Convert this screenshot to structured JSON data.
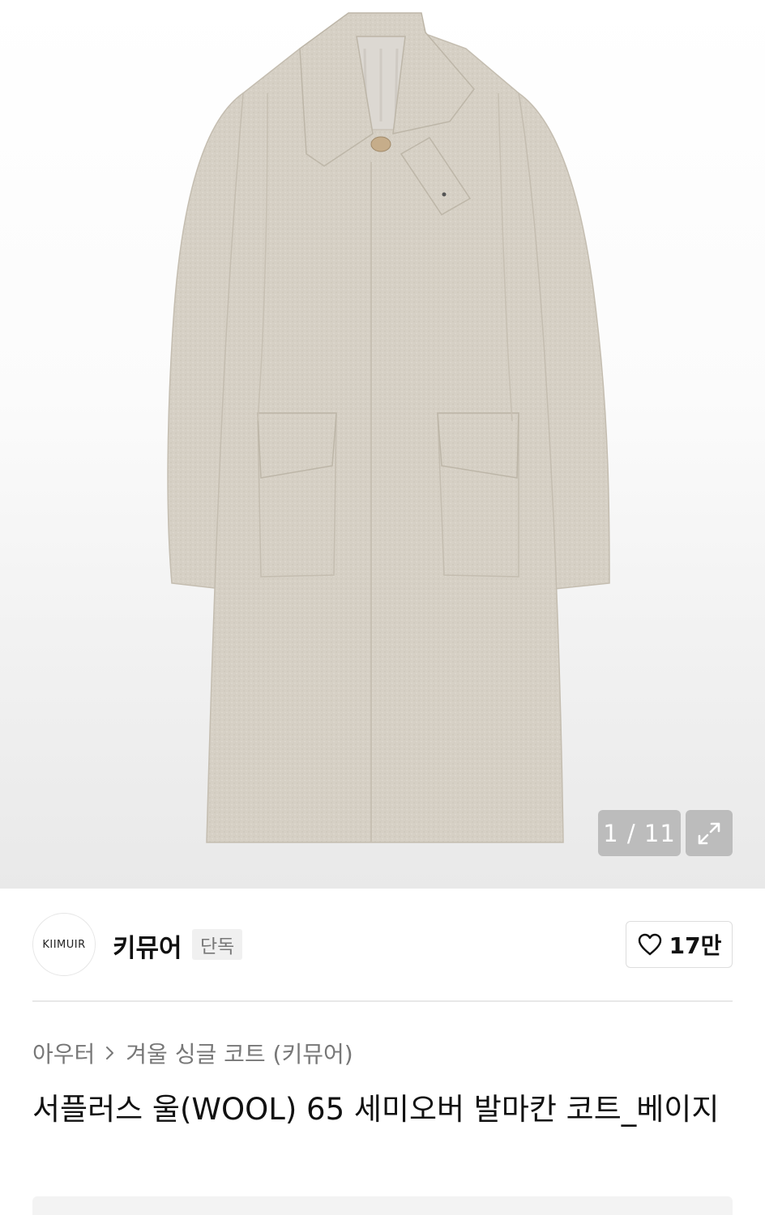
{
  "gallery": {
    "counter": "1 / 11",
    "image_alt": "coat"
  },
  "brand": {
    "logo_text": "KIIMUIR",
    "name": "키뮤어",
    "badge": "단독",
    "like_count": "17만"
  },
  "breadcrumb": {
    "category": "아우터",
    "subcategory": "겨울 싱글 코트 (키뮤어)"
  },
  "product": {
    "title": "서플러스 울(WOOL) 65 세미오버 발마칸 코트_베이지"
  },
  "colors": {
    "coat": "#d8d2c7",
    "accent": "#111111"
  },
  "icons": [
    "expand-icon",
    "heart-icon",
    "chevron-right-icon"
  ]
}
